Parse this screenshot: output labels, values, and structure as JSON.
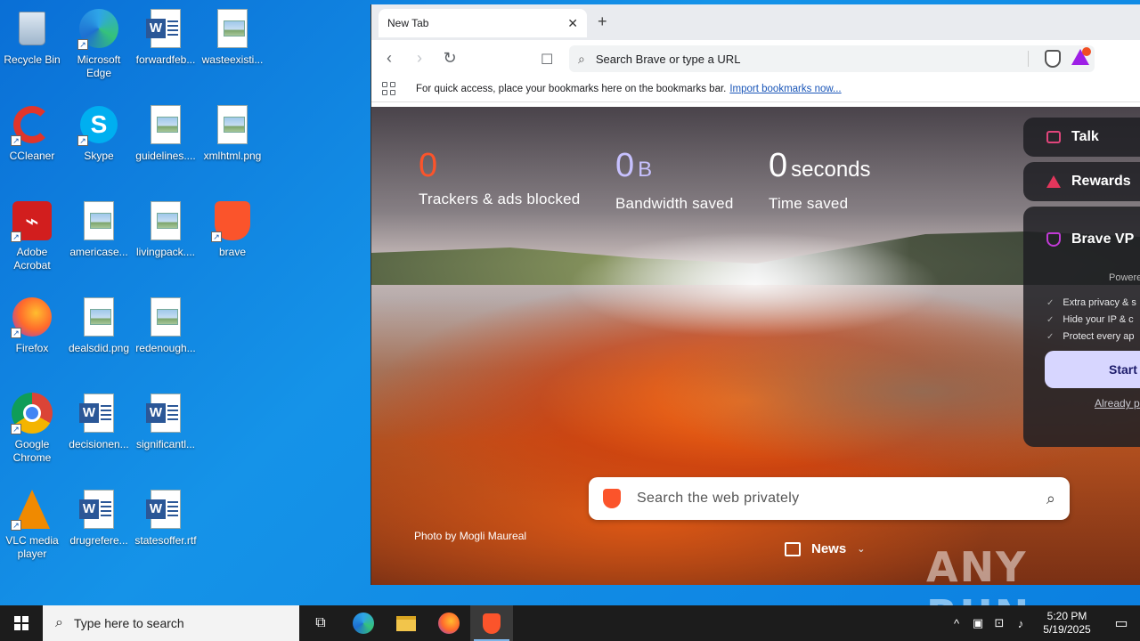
{
  "desktop": {
    "icons": [
      {
        "label": "Recycle Bin",
        "icon": "recycle-bin-icon"
      },
      {
        "label": "Microsoft Edge",
        "icon": "edge-icon"
      },
      {
        "label": "forwardfeb...",
        "icon": "word-doc-icon"
      },
      {
        "label": "wasteexisti...",
        "icon": "image-file-icon"
      },
      {
        "label": "CCleaner",
        "icon": "ccleaner-icon"
      },
      {
        "label": "Skype",
        "icon": "skype-icon"
      },
      {
        "label": "guidelines....",
        "icon": "image-file-icon"
      },
      {
        "label": "xmlhtml.png",
        "icon": "image-file-icon"
      },
      {
        "label": "Adobe Acrobat",
        "icon": "acrobat-icon"
      },
      {
        "label": "americase...",
        "icon": "image-file-icon"
      },
      {
        "label": "livingpack....",
        "icon": "image-file-icon"
      },
      {
        "label": "brave",
        "icon": "brave-icon"
      },
      {
        "label": "Firefox",
        "icon": "firefox-icon"
      },
      {
        "label": "dealsdid.png",
        "icon": "image-file-icon"
      },
      {
        "label": "redenough...",
        "icon": "image-file-icon"
      },
      {
        "label": "Google Chrome",
        "icon": "chrome-icon"
      },
      {
        "label": "decisionen...",
        "icon": "word-doc-icon"
      },
      {
        "label": "significantl...",
        "icon": "word-doc-icon"
      },
      {
        "label": "VLC media player",
        "icon": "vlc-icon"
      },
      {
        "label": "drugrefere...",
        "icon": "word-doc-icon"
      },
      {
        "label": "statesoffer.rtf",
        "icon": "word-doc-icon"
      }
    ]
  },
  "browser": {
    "tab_title": "New Tab",
    "url_placeholder": "Search Brave or type a URL",
    "bookmarks_hint": "For quick access, place your bookmarks here on the bookmarks bar.",
    "bookmarks_import": "Import bookmarks now...",
    "stats": {
      "trackers_value": "0",
      "trackers_label": "Trackers & ads blocked",
      "bandwidth_value": "0",
      "bandwidth_unit": "B",
      "bandwidth_label": "Bandwidth saved",
      "time_value": "0",
      "time_unit": "seconds",
      "time_label": "Time saved"
    },
    "widgets": {
      "talk": "Talk",
      "rewards": "Rewards",
      "vpn_title": "Brave VP",
      "vpn_powered": "Powered",
      "vpn_features": [
        "Extra privacy & s",
        "Hide your IP & c",
        "Protect every ap"
      ],
      "vpn_start": "Start",
      "vpn_already": "Already purch"
    },
    "search_placeholder": "Search the web privately",
    "photo_credit": "Photo by Mogli Maureal",
    "news_label": "News"
  },
  "watermark": "ANY RUN",
  "taskbar": {
    "search_placeholder": "Type here to search",
    "time": "5:20 PM",
    "date": "5/19/2025"
  },
  "colors": {
    "desktop_bg": "#0a7fe0",
    "brave_orange": "#fb542b",
    "tracker_count": "#fb542b",
    "bandwidth_count": "#c7c1ff"
  }
}
